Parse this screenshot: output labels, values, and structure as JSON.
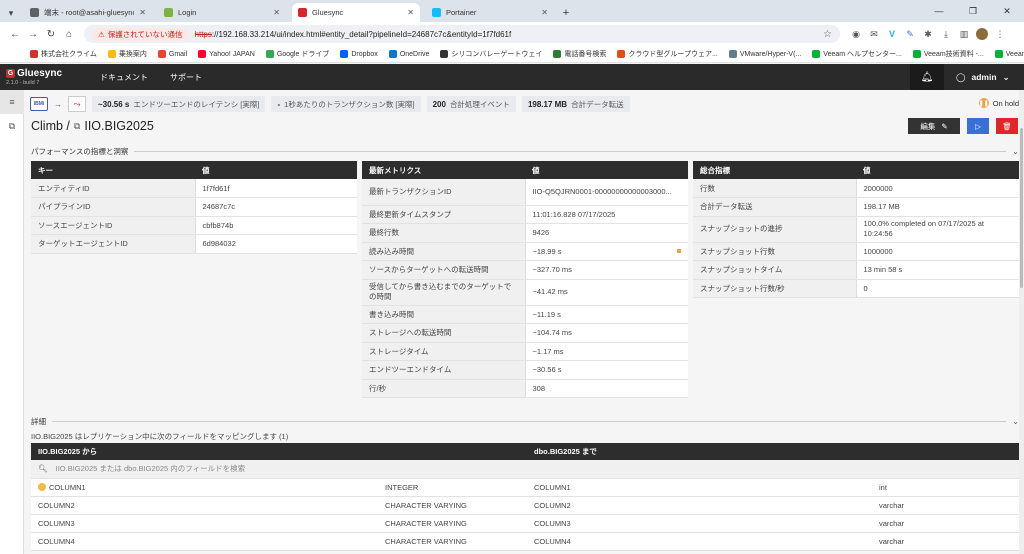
{
  "browser": {
    "tabs": [
      {
        "title": "端末 - root@asahi-gluesync",
        "color": "#5f6368"
      },
      {
        "title": "Login",
        "color": "#7cb342"
      },
      {
        "title": "Gluesync",
        "color": "#d9232d"
      },
      {
        "title": "Portainer",
        "color": "#13bef9"
      }
    ],
    "security_label": "保護されていない通信",
    "url_scheme": "https",
    "url_rest": "://192.168.33.214/ui/index.html#entity_detail?pipelineId=24687c7c&entityId=1f7fd61f",
    "bookmarks": [
      {
        "label": "株式会社クライム",
        "color": "#d32f2f"
      },
      {
        "label": "乗換案内",
        "color": "#fbbc05"
      },
      {
        "label": "Gmail",
        "color": "#ea4335"
      },
      {
        "label": "Yahoo! JAPAN",
        "color": "#ff0033"
      },
      {
        "label": "Google ドライブ",
        "color": "#34a853"
      },
      {
        "label": "Dropbox",
        "color": "#0061fe"
      },
      {
        "label": "OneDrive",
        "color": "#0078d4"
      },
      {
        "label": "シリコンバレーゲートウェイ",
        "color": "#333333"
      },
      {
        "label": "電話番号検索",
        "color": "#2e7d32"
      },
      {
        "label": "クラウド型グループウェア...",
        "color": "#e64a19"
      },
      {
        "label": "VMware/Hyper-V(...",
        "color": "#607d8b"
      },
      {
        "label": "Veeam ヘルプセンター...",
        "color": "#00b336"
      },
      {
        "label": "Veeam技術資料 -...",
        "color": "#00b336"
      },
      {
        "label": "Veeam Software - C...",
        "color": "#00b336"
      }
    ]
  },
  "app": {
    "brand": "Gluesync",
    "version": "2.1.0 - build 7",
    "nav": [
      "ドキュメント",
      "サポート"
    ],
    "user": "admin"
  },
  "pipeline": {
    "source_badge": "IBMi",
    "metrics": [
      {
        "value": "~30.56 s",
        "label": "エンドツーエンドのレイテンシ [実際]"
      },
      {
        "value": "-",
        "label": "1秒あたりのトランザクション数 [実際]"
      },
      {
        "value": "200",
        "label": "合計処理イベント"
      },
      {
        "value": "198.17 MB",
        "label": "合計データ転送"
      }
    ],
    "status": "On hold"
  },
  "page": {
    "breadcrumb": "Climb /",
    "title": "IIO.BIG2025",
    "edit_label": "編集",
    "perf_section": "パフォーマンスの指標と洞察",
    "details_section": "詳細",
    "mapping_text": "IIO.BIG2025 はレプリケーション中に次のフィールドをマッピングします (1)"
  },
  "info_table": {
    "headers": [
      "キー",
      "値"
    ],
    "rows": [
      [
        "エンティティID",
        "1f7fd61f"
      ],
      [
        "パイプラインID",
        "24687c7c"
      ],
      [
        "ソースエージェントID",
        "cbfb874b"
      ],
      [
        "ターゲットエージェントID",
        "6d984032"
      ]
    ]
  },
  "latest_table": {
    "headers": [
      "最新メトリクス",
      "値"
    ],
    "rows": [
      [
        "最新トランザクションID",
        "IIO-Q5QJRN0001-00000000000003000..."
      ],
      [
        "最終更新タイムスタンプ",
        "11:01:16.828 07/17/2025"
      ],
      [
        "最終行数",
        "9426"
      ],
      [
        "読み込み時間",
        "~18.99 s"
      ],
      [
        "ソースからターゲットへの転送時間",
        "~327.70 ms"
      ],
      [
        "受信してから書き込むまでのターゲットでの時間",
        "~41.42 ms"
      ],
      [
        "書き込み時間",
        "~11.19 s"
      ],
      [
        "ストレージへの転送時間",
        "~104.74 ms"
      ],
      [
        "ストレージタイム",
        "~1.17 ms"
      ],
      [
        "エンドツーエンドタイム",
        "~30.56 s"
      ],
      [
        "行/秒",
        "308"
      ]
    ]
  },
  "total_table": {
    "headers": [
      "総合指標",
      "値"
    ],
    "rows": [
      [
        "行数",
        "2000000"
      ],
      [
        "合計データ転送",
        "198.17 MB"
      ],
      [
        "スナップショットの進捗",
        "100.0% completed on 07/17/2025 at 10:24:56"
      ],
      [
        "スナップショット行数",
        "1000000"
      ],
      [
        "スナップショットタイム",
        "13 min 58 s"
      ],
      [
        "スナップショット行数/秒",
        "0"
      ]
    ]
  },
  "fields_table": {
    "headers": [
      "IIO.BIG2025 から",
      "",
      "dbo.BIG2025 まで",
      ""
    ],
    "search_placeholder": "IIO.BIG2025 または dbo.BIG2025 内のフィールドを検索",
    "rows": [
      [
        "COLUMN1",
        "INTEGER",
        "COLUMN1",
        "int"
      ],
      [
        "COLUMN2",
        "CHARACTER VARYING",
        "COLUMN2",
        "varchar"
      ],
      [
        "COLUMN3",
        "CHARACTER VARYING",
        "COLUMN3",
        "varchar"
      ],
      [
        "COLUMN4",
        "CHARACTER VARYING",
        "COLUMN4",
        "varchar"
      ]
    ]
  }
}
